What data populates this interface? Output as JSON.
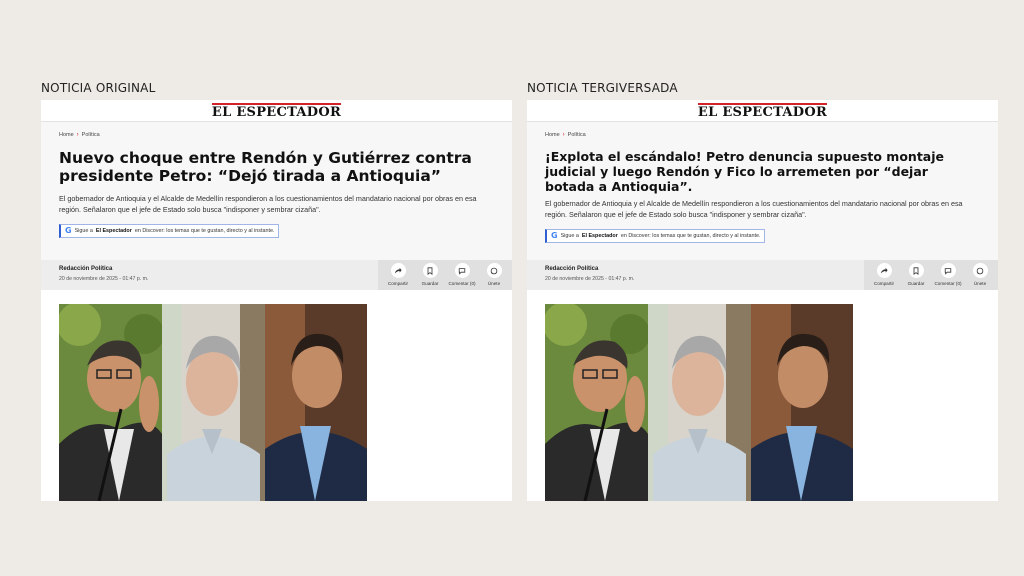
{
  "panels": [
    {
      "label": "NOTICIA ORIGINAL",
      "brand": "EL ESPECTADOR",
      "breadcrumb": [
        "Home",
        "Política"
      ],
      "headline": "Nuevo choque entre Rendón y Gutiérrez contra presidente Petro: “Dejó tirada a Antioquia”",
      "lead": "El gobernador de Antioquia y el Alcalde de Medellín respondieron a los cuestionamientos del mandatario nacional por obras en esa región. Señalaron que el jefe de Estado solo busca \"indisponer y sembrar cizaña\".",
      "discover": {
        "prefix": "Sigue a",
        "brand": "El Espectador",
        "suffix": "en Discover: los temas que te gustan, directo y al instante."
      },
      "author": "Redacción Política",
      "date": "20 de noviembre de 2025 - 01:47 p. m.",
      "actions": [
        "Compartir",
        "Guardar",
        "Comentar (0)",
        "Únete"
      ]
    },
    {
      "label": "NOTICIA TERGIVERSADA",
      "brand": "EL ESPECTADOR",
      "breadcrumb": [
        "Home",
        "Política"
      ],
      "headline": "¡Explota el escándalo! Petro denuncia supuesto montaje judicial y luego Rendón y Fico lo arremeten por “dejar botada a Antioquia”.",
      "lead": "El gobernador de Antioquia y el Alcalde de Medellín respondieron a los cuestionamientos del mandatario nacional por obras en esa región. Señalaron que el jefe de Estado solo busca \"indisponer y sembrar cizaña\".",
      "discover": {
        "prefix": "Sigue a",
        "brand": "El Espectador",
        "suffix": "en Discover: los temas que te gustan, directo y al instante."
      },
      "author": "Redacción Política",
      "date": "20 de noviembre de 2025 - 01:47 p. m.",
      "actions": [
        "Compartir",
        "Guardar",
        "Comentar (0)",
        "Únete"
      ]
    }
  ],
  "icons": [
    "share-icon",
    "bookmark-icon",
    "comment-icon",
    "whatsapp-icon",
    "google-icon"
  ],
  "colors": {
    "background": "#eeebe6",
    "brand_red": "#d2232a",
    "discover_blue": "#2f5fd0"
  }
}
